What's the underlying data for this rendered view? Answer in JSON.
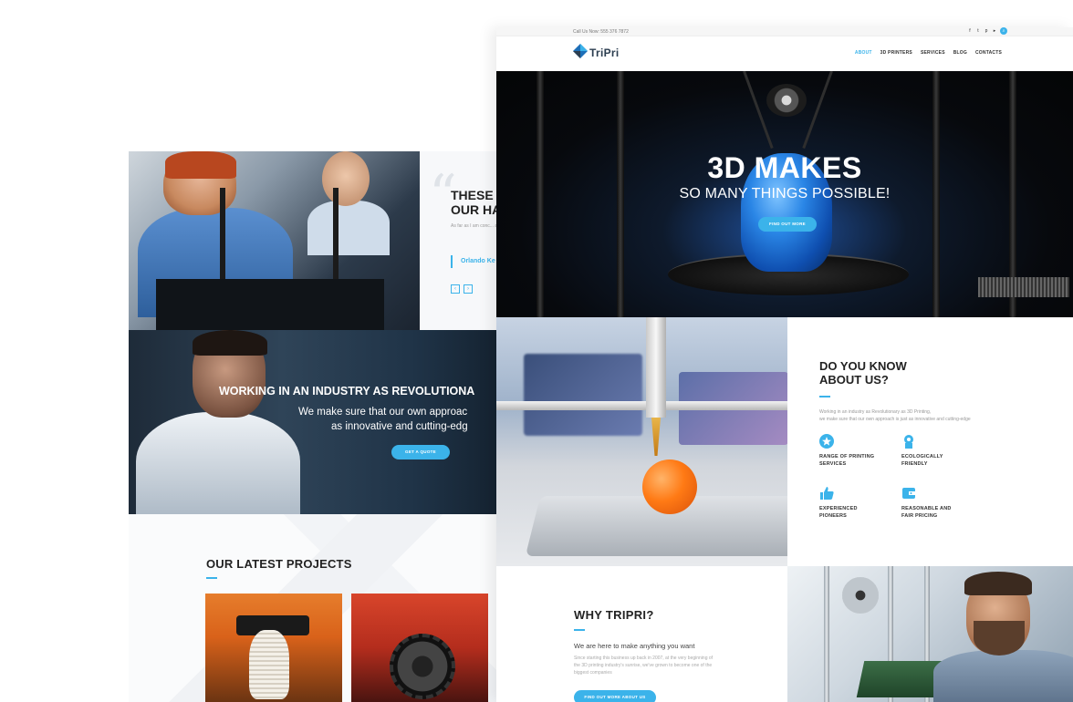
{
  "back_page": {
    "testimonial": {
      "title": "THESE A... OUR HA...",
      "title_line1": "THESE A",
      "title_line2": "OUR HA",
      "text": "As far as I am conc... all over the US to m... plenty so much m...",
      "author": "Orlando Ke"
    },
    "banner": {
      "title": "WORKING IN AN INDUSTRY AS REVOLUTIONA",
      "subtitle_line1": "We make sure that our own approac",
      "subtitle_line2": "as innovative and cutting-edg",
      "button": "GET A QUOTE"
    },
    "projects": {
      "title": "OUR LATEST PROJECTS"
    }
  },
  "front_page": {
    "topbar": {
      "call_us": "Call Us Now: 555 376 7872",
      "socials": [
        "facebook-icon",
        "twitter-icon",
        "pinterest-icon",
        "youtube-icon"
      ]
    },
    "brand": {
      "name": "TriPri"
    },
    "nav": {
      "items": [
        {
          "label": "ABOUT",
          "active": true
        },
        {
          "label": "3D PRINTERS",
          "active": false
        },
        {
          "label": "SERVICES",
          "active": false
        },
        {
          "label": "BLOG",
          "active": false
        },
        {
          "label": "CONTACTS",
          "active": false
        }
      ]
    },
    "hero": {
      "title": "3D MAKES",
      "subtitle": "SO MANY THINGS POSSIBLE!",
      "button": "FIND OUT MORE"
    },
    "about": {
      "title": "DO YOU KNOW ABOUT US?",
      "title_line1": "DO YOU KNOW",
      "title_line2": "ABOUT US?",
      "desc_line1": "Working in an industry as Revolutionary as 3D Printing,",
      "desc_line2": "we make sure that our own approach is just as innovative and cutting-edge",
      "features": [
        {
          "icon": "star-badge-icon",
          "line1": "RANGE OF PRINTING",
          "line2": "SERVICES"
        },
        {
          "icon": "eco-badge-icon",
          "line1": "ECOLOGICALLY",
          "line2": "FRIENDLY"
        },
        {
          "icon": "thumbs-up-icon",
          "line1": "EXPERIENCED",
          "line2": "PIONEERS"
        },
        {
          "icon": "wallet-icon",
          "line1": "REASONABLE AND",
          "line2": "FAIR PRICING"
        }
      ]
    },
    "why": {
      "title": "WHY TRIPRI?",
      "lead": "We are here to make anything you want",
      "desc": "Since starting this business up back in 2007, at the very beginning of the 3D printing industry's sunrise, we've grown to become one of the biggest companies",
      "button": "FIND OUT MORE ABOUT US"
    }
  },
  "colors": {
    "accent": "#3bb3ea",
    "dark_text": "#222222",
    "muted_text": "#999999"
  }
}
